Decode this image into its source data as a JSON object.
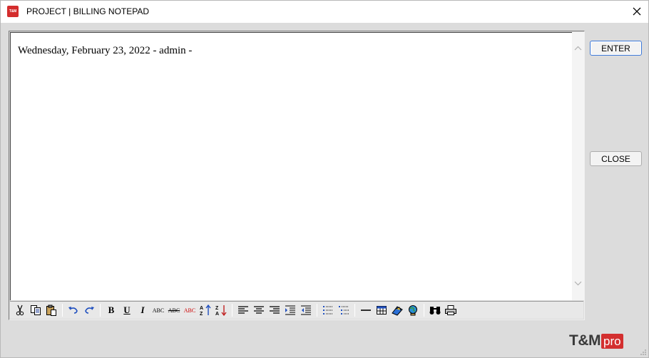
{
  "window": {
    "title": "PROJECT | BILLING NOTEPAD",
    "icon_text": "T&M",
    "icon": "app-logo-icon",
    "close_icon": "close-icon"
  },
  "editor": {
    "content": "Wednesday, February 23, 2022 - admin -"
  },
  "buttons": {
    "enter_label": "ENTER",
    "close_label": "CLOSE"
  },
  "toolbar": {
    "groups": [
      [
        "cut-icon",
        "copy-icon",
        "paste-icon"
      ],
      [
        "undo-icon",
        "redo-icon"
      ],
      [
        "bold-icon",
        "underline-icon",
        "italic-icon",
        "strikethrough-icon",
        "spellcheck-icon",
        "font-color-icon",
        "sort-ascending-icon",
        "sort-descending-icon"
      ],
      [
        "align-left-icon",
        "align-center-icon",
        "align-right-icon",
        "indent-icon",
        "outdent-icon"
      ],
      [
        "bullet-list-icon",
        "numbered-list-icon"
      ],
      [
        "horizontal-line-icon",
        "table-icon",
        "insert-image-icon",
        "hyperlink-icon"
      ],
      [
        "find-icon",
        "print-icon"
      ]
    ],
    "labels": {
      "bold": "B",
      "underline": "U",
      "italic": "I",
      "strike": "ABC",
      "spell": "ABC",
      "color": "ABC"
    }
  },
  "brand": {
    "logo_main": "T&M",
    "logo_accent": "pro",
    "accent_color": "#d32f2f"
  }
}
